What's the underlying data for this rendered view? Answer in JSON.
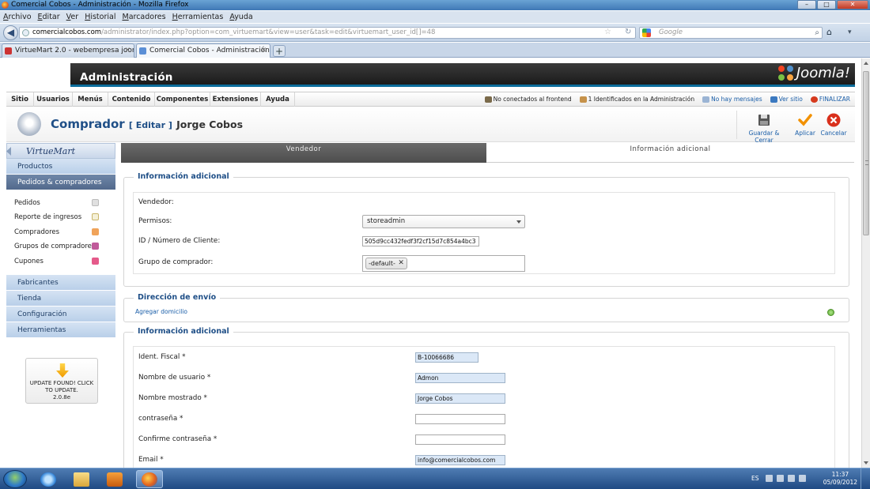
{
  "window": {
    "title": "Comercial Cobos - Administración - Mozilla Firefox"
  },
  "menubar": [
    "Archivo",
    "Editar",
    "Ver",
    "Historial",
    "Marcadores",
    "Herramientas",
    "Ayuda"
  ],
  "browser": {
    "url_domain": "comercialcobos.com",
    "url_path": "/administrator/index.php?option=com_virtuemart&view=user&task=edit&virtuemart_user_id[]=48",
    "search_placeholder": "Google"
  },
  "tabs": [
    {
      "label": "VirtueMart 2.0 - webempresa joomla ...",
      "active": false
    },
    {
      "label": "Comercial Cobos - Administración",
      "active": true
    }
  ],
  "joomla": {
    "admin_title": "Administración",
    "logo_text": "Joomla!",
    "menu": [
      "Sitio",
      "Usuarios",
      "Menús",
      "Contenido",
      "Componentes",
      "Extensiones",
      "Ayuda"
    ],
    "status": [
      "No conectados al frontend",
      "1 Identificados en la Administración",
      "No hay mensajes",
      "Ver sitio",
      "FINALIZAR"
    ]
  },
  "toolbar": {
    "title": "Comprador",
    "edit": "[ Editar ]",
    "name": "Jorge Cobos",
    "buttons": [
      "Guardar & Cerrar",
      "Aplicar",
      "Cancelar"
    ]
  },
  "sidebar": {
    "logo": "VirtueMart",
    "sections_top": [
      "Productos",
      "Pedidos & compradores"
    ],
    "sub_items": [
      "Pedidos",
      "Reporte de ingresos",
      "Compradores",
      "Grupos de compradores",
      "Cupones"
    ],
    "sections_bottom": [
      "Fabricantes",
      "Tienda",
      "Configuración",
      "Herramientas"
    ],
    "update_text": "UPDATE FOUND! CLICK TO UPDATE.",
    "update_version": "2.0.8e"
  },
  "content": {
    "tabs": [
      "Vendedor",
      "Información adicional"
    ],
    "section1": {
      "legend": "Información adicional",
      "vendor_label": "Vendedor:",
      "perm_label": "Permisos:",
      "perm_value": "storeadmin",
      "id_label": "ID / Número de Cliente:",
      "id_value": "505d9cc432fedf3f2cf15d7c854a4bc3",
      "group_label": "Grupo de comprador:",
      "group_chip": "-default-"
    },
    "section2": {
      "legend": "Dirección de envío",
      "add_link": "Agregar domicilio"
    },
    "section3": {
      "legend": "Información adicional",
      "fields": [
        {
          "label": "Ident. Fiscal *",
          "value": "B-10066686"
        },
        {
          "label": "Nombre de usuario *",
          "value": "Admon"
        },
        {
          "label": "Nombre mostrado *",
          "value": "Jorge Cobos"
        },
        {
          "label": "contraseña *",
          "value": ""
        },
        {
          "label": "Confirme contraseña *",
          "value": ""
        },
        {
          "label": "Email *",
          "value": "info@comercialcobos.com"
        }
      ]
    }
  },
  "taskbar": {
    "lang": "ES",
    "time": "11:37",
    "date": "05/09/2012"
  }
}
